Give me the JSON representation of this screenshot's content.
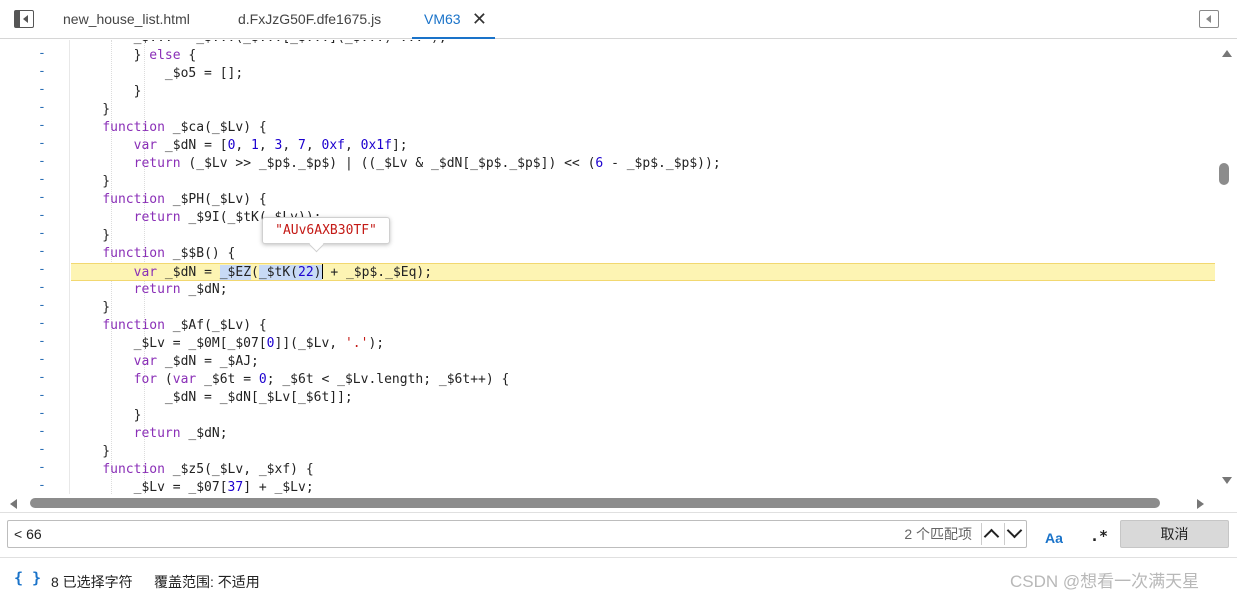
{
  "tabs": [
    {
      "label": "new_house_list.html"
    },
    {
      "label": "d.FxJzG50F.dfe1675.js"
    },
    {
      "label": "VM63",
      "close": "✕"
    }
  ],
  "gutter_marker": "-",
  "tooltip_value": "\"AUv6AXB30TF\"",
  "search": {
    "value": "< 66",
    "match_count": "2 个匹配项",
    "case_label": "Aa",
    "regex_label": ".*",
    "cancel_label": "取消"
  },
  "status": {
    "braces": "{ }",
    "selection": "8 已选择字符",
    "coverage": "覆盖范围: 不适用"
  },
  "watermark": "CSDN @想看一次满天星",
  "colors": {
    "accent": "#1a73c9",
    "keyword": "#8a2fb7",
    "number": "#1c00cf",
    "string": "#c41a16",
    "highlight_line": "#fdf4b3",
    "selection": "#c8daf6"
  },
  "icons": {
    "left_panel": "sidebar-toggle-icon",
    "right_panel": "sidebar-toggle-icon",
    "prev": "chevron-up-icon",
    "next": "chevron-down-icon"
  }
}
